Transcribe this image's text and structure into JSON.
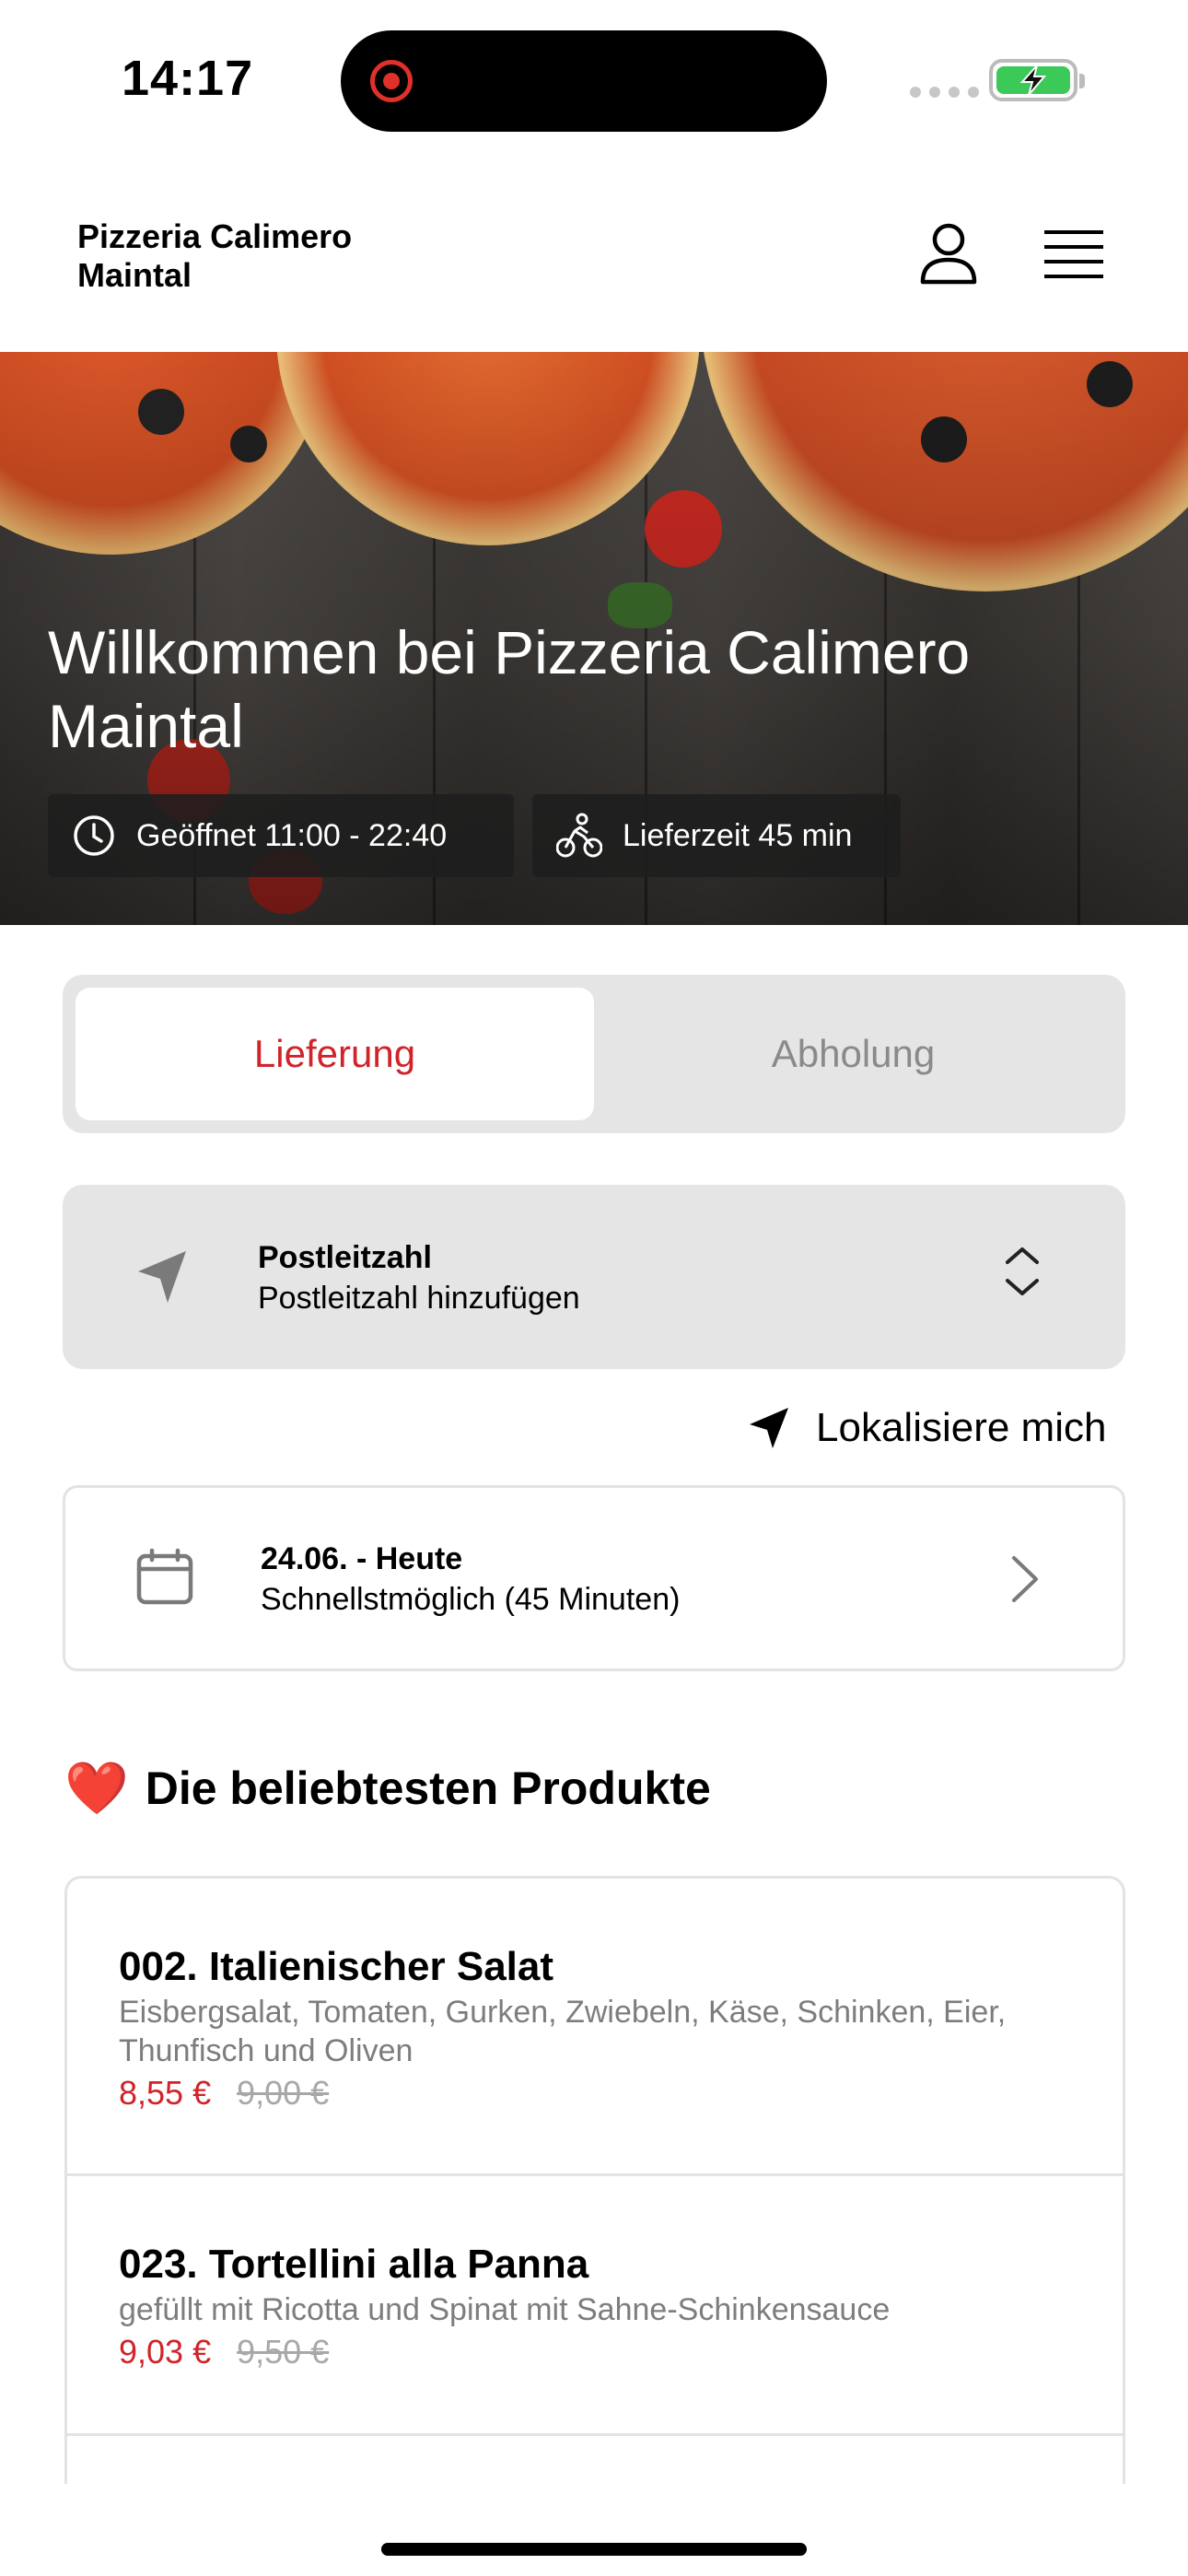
{
  "status_bar": {
    "time": "14:17"
  },
  "header": {
    "brand": "Pizzeria Calimero\nMaintal"
  },
  "hero": {
    "title": "Willkommen bei Pizzeria Calimero Maintal",
    "open_hours": "Geöffnet 11:00 - 22:40",
    "delivery_time": "Lieferzeit 45 min"
  },
  "order_mode": {
    "tabs": [
      {
        "label": "Lieferung",
        "selected": true
      },
      {
        "label": "Abholung",
        "selected": false
      }
    ]
  },
  "zip": {
    "label": "Postleitzahl",
    "value": "Postleitzahl hinzufügen"
  },
  "locate": {
    "label": "Lokalisiere mich"
  },
  "date": {
    "label": "24.06. - Heute",
    "value": "Schnellstmöglich (45 Minuten)"
  },
  "popular": {
    "emoji": "❤️",
    "title": "Die beliebtesten Produkte",
    "items": [
      {
        "name": "002. Italienischer Salat",
        "description": "Eisbergsalat, Tomaten, Gurken, Zwiebeln, Käse, Schinken, Eier, Thunfisch und Oliven",
        "price": "8,55 €",
        "old_price": "9,00 €"
      },
      {
        "name": "023. Tortellini alla Panna",
        "description": "gefüllt mit Ricotta und Spinat mit Sahne-Schinkensauce",
        "price": "9,03 €",
        "old_price": "9,50 €"
      }
    ]
  },
  "colors": {
    "accent": "#d0232a",
    "panel": "#e5e5e5",
    "border": "#e3e3e3"
  }
}
